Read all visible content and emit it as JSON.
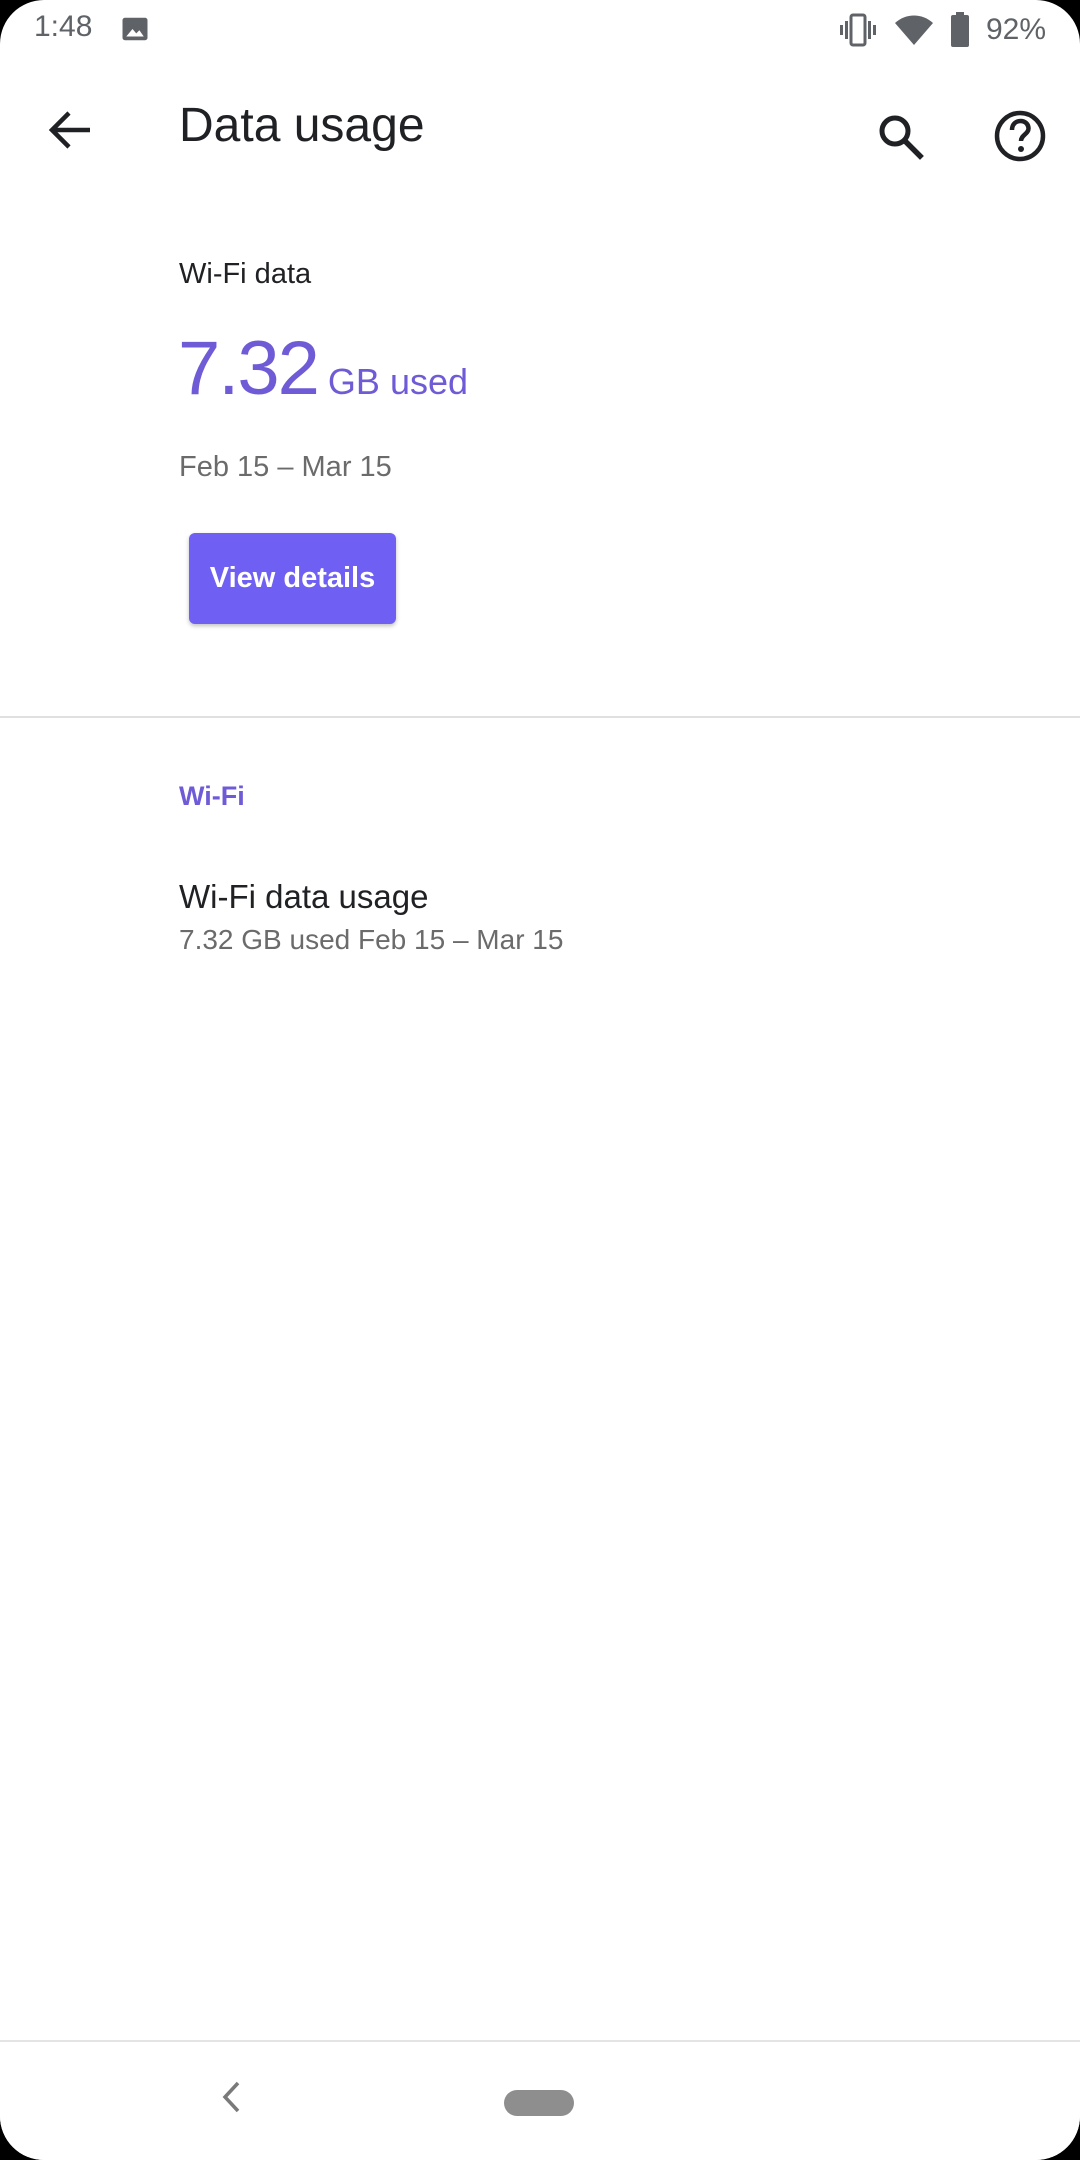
{
  "status_bar": {
    "time": "1:48",
    "battery_percent": "92%",
    "icons": [
      "image-icon",
      "vibrate-icon",
      "wifi-icon",
      "battery-icon"
    ]
  },
  "toolbar": {
    "title": "Data usage",
    "back_icon": "arrow-back-icon",
    "search_icon": "search-icon",
    "help_icon": "help-icon"
  },
  "summary": {
    "label": "Wi-Fi data",
    "value": "7.32",
    "unit": "GB used",
    "period": "Feb 15 – Mar 15",
    "button_label": "View details"
  },
  "wifi_section": {
    "header": "Wi-Fi",
    "item": {
      "title": "Wi-Fi data usage",
      "summary": "7.32 GB used Feb 15 – Mar 15"
    }
  },
  "nav_bar": {
    "back_icon": "nav-back-icon",
    "home_icon": "home-pill-icon"
  },
  "colors": {
    "accent": "#6f5bd6",
    "button": "#6f5ff2",
    "text_primary": "#202124",
    "text_secondary": "#6b6b6b"
  }
}
